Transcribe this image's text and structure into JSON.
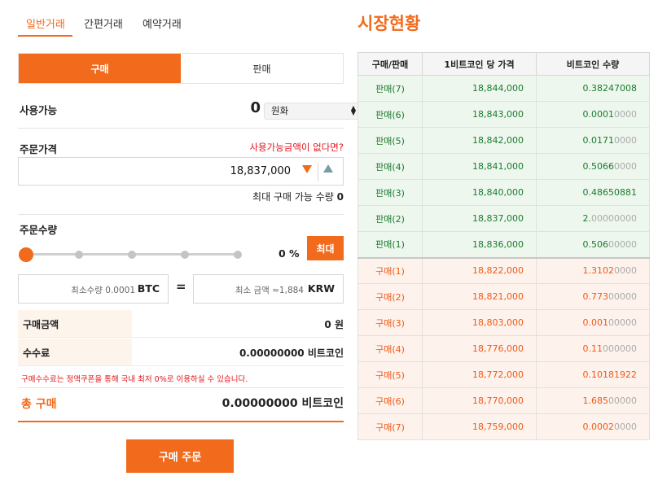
{
  "colors": {
    "accent": "#f26a1b",
    "sell_green": "#1a7a2e",
    "buy_orange": "#f0591a",
    "alert_red": "#e3151b"
  },
  "tabs": [
    "일반거래",
    "간편거래",
    "예약거래"
  ],
  "toggle": {
    "buy": "구매",
    "sell": "판매"
  },
  "available": {
    "label": "사용가능",
    "amount": "0",
    "currency": "원화"
  },
  "price": {
    "label": "주문가격",
    "link": "사용가능금액이 없다면?",
    "value": "18,837,000"
  },
  "max_qty": {
    "label": "최대 구매 가능 수량",
    "value": "0"
  },
  "quantity": {
    "label": "주문수량",
    "percent": "0 %",
    "max_button": "최대",
    "slider_level": 0
  },
  "convert": {
    "btc_placeholder": "최소수량 0.0001",
    "btc_unit": "BTC",
    "equals": "=",
    "krw_placeholder": "최소 금액 ≈1,884",
    "krw_unit": "KRW"
  },
  "summary": {
    "amount_label": "구매금액",
    "amount_value": "0 원",
    "fee_label": "수수료",
    "fee_value": "0.00000000 비트코인",
    "notice": "구매수수료는 정액쿠폰을 통해 국내 최저 0%로 이용하실 수 있습니다.",
    "total_label": "총 구매",
    "total_value": "0.00000000 비트코인"
  },
  "order_button": "구매 주문",
  "market": {
    "title": "시장현황",
    "headers": [
      "구매/판매",
      "1비트코인 당 가격",
      "비트코인 수량"
    ],
    "rows": [
      {
        "side": "sell",
        "type": "판매(7)",
        "price": "18,844,000",
        "qty_main": "0.38247008",
        "qty_dim": ""
      },
      {
        "side": "sell",
        "type": "판매(6)",
        "price": "18,843,000",
        "qty_main": "0.0001",
        "qty_dim": "0000"
      },
      {
        "side": "sell",
        "type": "판매(5)",
        "price": "18,842,000",
        "qty_main": "0.0171",
        "qty_dim": "0000"
      },
      {
        "side": "sell",
        "type": "판매(4)",
        "price": "18,841,000",
        "qty_main": "0.5066",
        "qty_dim": "0000"
      },
      {
        "side": "sell",
        "type": "판매(3)",
        "price": "18,840,000",
        "qty_main": "0.48650881",
        "qty_dim": ""
      },
      {
        "side": "sell",
        "type": "판매(2)",
        "price": "18,837,000",
        "qty_main": "2.",
        "qty_dim": "00000000"
      },
      {
        "side": "sell",
        "type": "판매(1)",
        "price": "18,836,000",
        "qty_main": "0.506",
        "qty_dim": "00000"
      },
      {
        "side": "buy",
        "type": "구매(1)",
        "price": "18,822,000",
        "qty_main": "1.3102",
        "qty_dim": "0000"
      },
      {
        "side": "buy",
        "type": "구매(2)",
        "price": "18,821,000",
        "qty_main": "0.773",
        "qty_dim": "00000"
      },
      {
        "side": "buy",
        "type": "구매(3)",
        "price": "18,803,000",
        "qty_main": "0.001",
        "qty_dim": "00000"
      },
      {
        "side": "buy",
        "type": "구매(4)",
        "price": "18,776,000",
        "qty_main": "0.11",
        "qty_dim": "000000"
      },
      {
        "side": "buy",
        "type": "구매(5)",
        "price": "18,772,000",
        "qty_main": "0.10181922",
        "qty_dim": ""
      },
      {
        "side": "buy",
        "type": "구매(6)",
        "price": "18,770,000",
        "qty_main": "1.685",
        "qty_dim": "00000"
      },
      {
        "side": "buy",
        "type": "구매(7)",
        "price": "18,759,000",
        "qty_main": "0.0002",
        "qty_dim": "0000"
      }
    ]
  }
}
